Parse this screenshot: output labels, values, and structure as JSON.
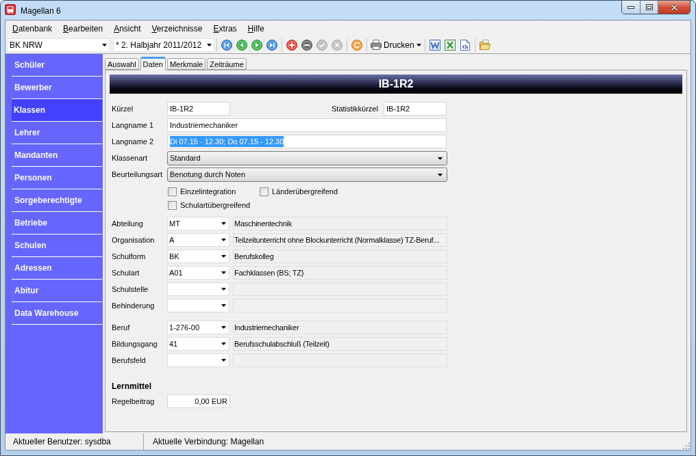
{
  "window": {
    "title": "Magellan 6"
  },
  "menu": [
    "Datenbank",
    "Bearbeiten",
    "Ansicht",
    "Verzeichnisse",
    "Extras",
    "Hilfe"
  ],
  "toolbar": {
    "selectors": [
      {
        "value": "BK NRW"
      },
      {
        "value": "* 2. Halbjahr 2011/2012"
      }
    ],
    "record_buttons": [
      {
        "disabled": false
      },
      {
        "disabled": false
      },
      {
        "disabled": true
      },
      {
        "disabled": true
      }
    ],
    "print_button": {
      "label": "Drucken"
    }
  },
  "sidebar": {
    "items": [
      {
        "label": "Schüler",
        "selected": false
      },
      {
        "label": "Bewerber",
        "selected": false
      },
      {
        "label": "Klassen",
        "selected": true
      },
      {
        "label": "Lehrer",
        "selected": false
      },
      {
        "label": "Mandanten",
        "selected": false
      },
      {
        "label": "Personen",
        "selected": false
      },
      {
        "label": "Sorgeberechtigte",
        "selected": false
      },
      {
        "label": "Betriebe",
        "selected": false
      },
      {
        "label": "Schulen",
        "selected": false
      },
      {
        "label": "Adressen",
        "selected": false
      },
      {
        "label": "Abitur",
        "selected": false
      },
      {
        "label": "Data Warehouse",
        "selected": false
      }
    ]
  },
  "tabs": [
    {
      "label": "Auswahl",
      "selected": false
    },
    {
      "label": "Daten",
      "selected": true
    },
    {
      "label": "Merkmale",
      "selected": false
    },
    {
      "label": "Zeiträume",
      "selected": false
    }
  ],
  "record": {
    "title": "IB-1R2"
  },
  "form": {
    "short_name": {
      "label": "Kürzel",
      "value": "IB-1R2"
    },
    "statistics_code": {
      "label": "Statistikkürzel",
      "value": "IB-1R2"
    },
    "text_fields": [
      {
        "label": "Langname 1",
        "value": "Industriemechaniker",
        "text_selected": false
      },
      {
        "label": "Langname 2",
        "value": "Di 07.15 - 12.30; Do 07.15 - 12.30",
        "text_selected": true
      }
    ],
    "dropdowns": [
      {
        "label": "Klassenart",
        "value": "Standard"
      },
      {
        "label": "Beurteilungsart",
        "value": "Benotung durch Noten"
      }
    ],
    "checkboxes": [
      {
        "label": "Einzelintegration",
        "checked": false
      },
      {
        "label": "Länderübergreifend",
        "checked": false
      },
      {
        "label": "Schulartübergreifend",
        "checked": false
      }
    ],
    "lookup_groups": [
      [
        {
          "label": "Abteilung",
          "code": "MT",
          "description": "Maschinentechnik"
        },
        {
          "label": "Organisation",
          "code": "A",
          "description": "Teilzeitunterricht ohne Blockunterricht (Normalklasse) TZ-Beruf..."
        },
        {
          "label": "Schulform",
          "code": "BK",
          "description": "Berufskolleg"
        },
        {
          "label": "Schulart",
          "code": "A01",
          "description": "Fachklassen (BS; TZ)"
        },
        {
          "label": "Schulstelle"
        },
        {
          "label": "Behinderung"
        }
      ],
      [
        {
          "label": "Beruf",
          "code": "1-276-00",
          "description": "Industriemechaniker"
        },
        {
          "label": "Bildungsgang",
          "code": "41",
          "description": "Berufsschulabschluß (Teilzeit)"
        },
        {
          "label": "Berufsfeld"
        }
      ]
    ],
    "lernmittel": {
      "heading": "Lernmittel",
      "label": "Regelbeitrag",
      "value": "0,00 EUR"
    }
  },
  "status_bar": [
    "Aktueller Benutzer: sysdba",
    "Aktuelle Verbindung: Magellan"
  ]
}
